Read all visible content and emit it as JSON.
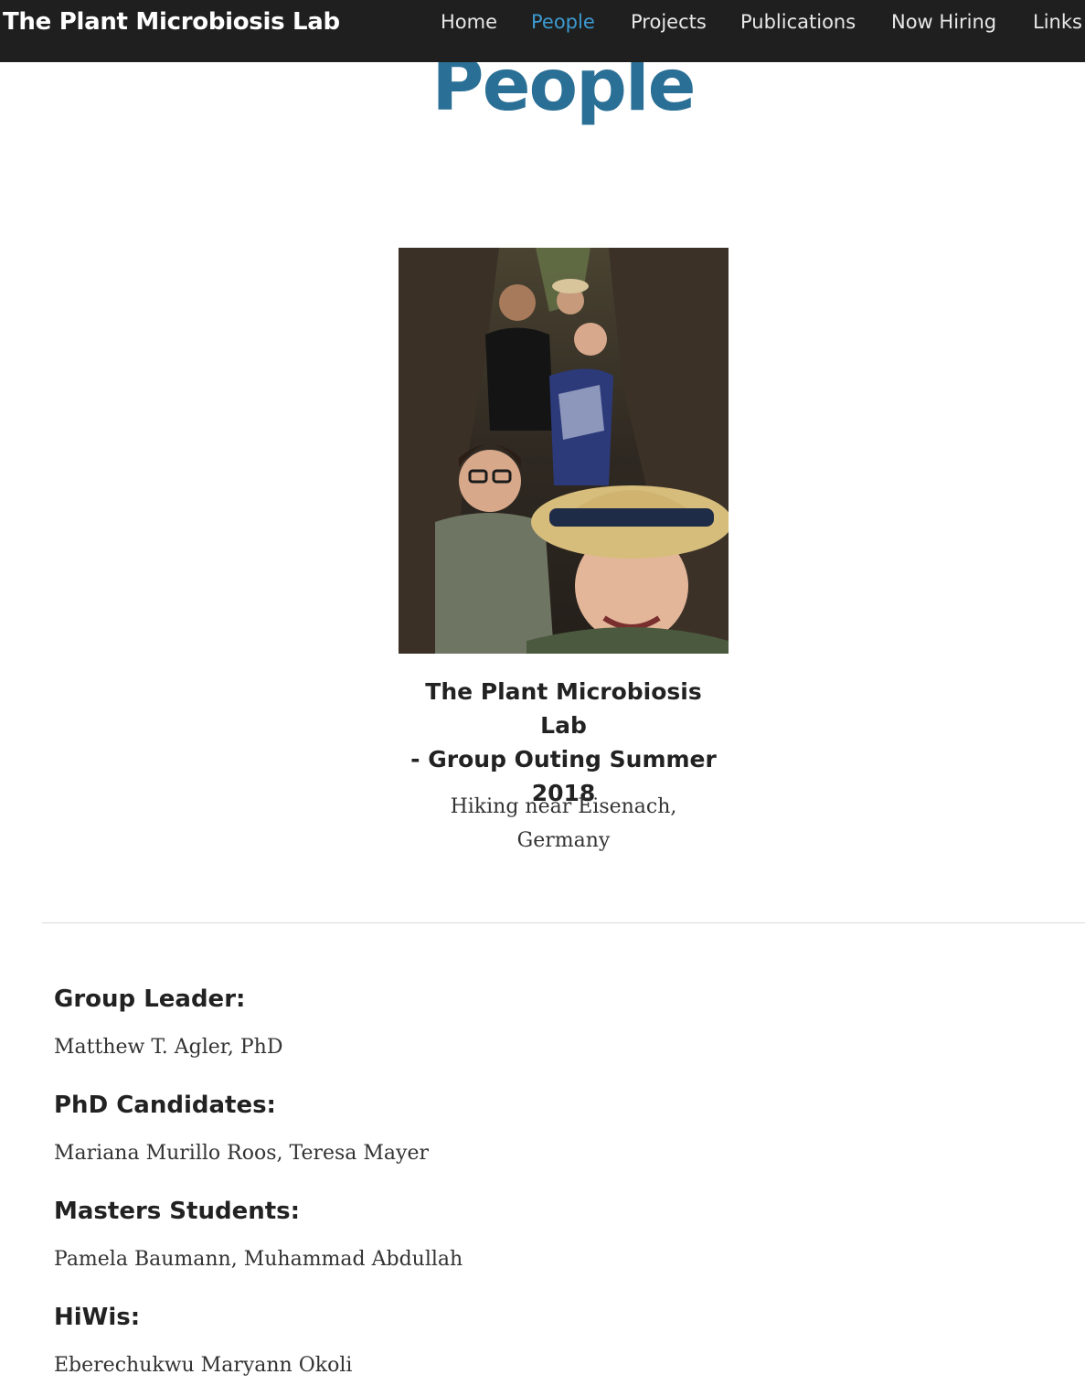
{
  "navbar": {
    "brand": "The Plant Microbiosis Lab",
    "items": [
      {
        "label": "Home",
        "active": false
      },
      {
        "label": "People",
        "active": true
      },
      {
        "label": "Projects",
        "active": false
      },
      {
        "label": "Publications",
        "active": false
      },
      {
        "label": "Now Hiring",
        "active": false
      },
      {
        "label": "Links",
        "active": false
      }
    ],
    "colors": {
      "background": "#1f1f1f",
      "active": "#3c9bd1",
      "text": "#e8e8e8"
    }
  },
  "page": {
    "title": "People",
    "title_color": "#2a6f96"
  },
  "photo": {
    "caption_title_lines": [
      "The Plant Microbiosis Lab",
      "- Group Outing Summer",
      "2018"
    ],
    "caption_sub_lines": [
      "Hiking near Eisenach,",
      "Germany"
    ]
  },
  "roster": [
    {
      "heading": "Group Leader:",
      "names": "Matthew T. Agler, PhD"
    },
    {
      "heading": "PhD Candidates:",
      "names": "Mariana Murillo Roos, Teresa Mayer"
    },
    {
      "heading": "Masters Students:",
      "names": "Pamela Baumann, Muhammad Abdullah"
    },
    {
      "heading": "HiWis:",
      "names": "Eberechukwu Maryann Okoli"
    }
  ]
}
